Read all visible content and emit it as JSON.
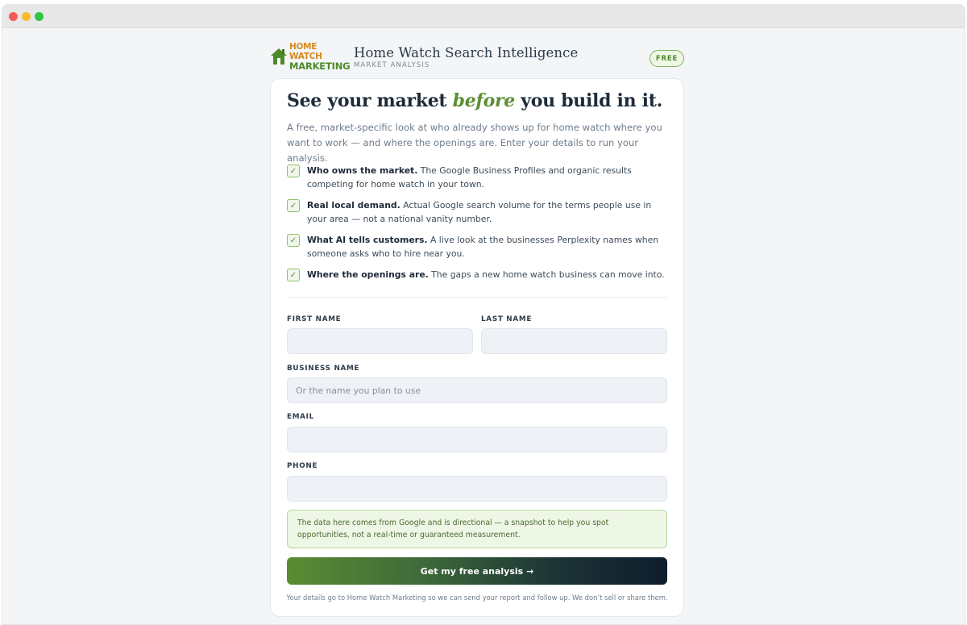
{
  "window": {
    "controls": [
      "close",
      "minimize",
      "maximize"
    ]
  },
  "header": {
    "logo": {
      "line1": "HOME WATCH",
      "line2": "MARKETING",
      "icon": "house-icon"
    },
    "title": "Home Watch Search Intelligence",
    "subtitle": "MARKET ANALYSIS",
    "badge": "FREE"
  },
  "hero": {
    "before": "See your market ",
    "accent": "before",
    "after": " you build in it."
  },
  "intro": "A free, market-specific look at who already shows up for home watch where you want to work — and where the openings are. Enter your details to run your analysis.",
  "features": [
    {
      "title": "Who owns the market.",
      "text": " The Google Business Profiles and organic results competing for home watch in your town."
    },
    {
      "title": "Real local demand.",
      "text": " Actual Google search volume for the terms people use in your area — not a national vanity number."
    },
    {
      "title": "What AI tells customers.",
      "text": " A live look at the businesses Perplexity names when someone asks who to hire near you."
    },
    {
      "title": "Where the openings are.",
      "text": " The gaps a new home watch business can move into."
    }
  ],
  "check_glyph": "✓",
  "form": {
    "first_name": {
      "label": "FIRST NAME",
      "value": "",
      "placeholder": ""
    },
    "last_name": {
      "label": "LAST NAME",
      "value": "",
      "placeholder": ""
    },
    "business_name": {
      "label": "BUSINESS NAME",
      "value": "",
      "placeholder": "Or the name you plan to use"
    },
    "email": {
      "label": "EMAIL",
      "value": "",
      "placeholder": ""
    },
    "phone": {
      "label": "PHONE",
      "value": "",
      "placeholder": ""
    }
  },
  "notice": "The data here comes from Google and is directional — a snapshot to help you spot opportunities, not a real-time or guaranteed measurement.",
  "cta": "Get my free analysis →",
  "fineprint": "Your details go to Home Watch Marketing so we can send your report and follow up. We don’t sell or share them.",
  "colors": {
    "accent_green": "#5c8f32",
    "logo_orange": "#d88a1f",
    "cta_gradient_start": "#5a8c32",
    "cta_gradient_end": "#0f1d2c",
    "notice_bg": "#eef6e6"
  }
}
